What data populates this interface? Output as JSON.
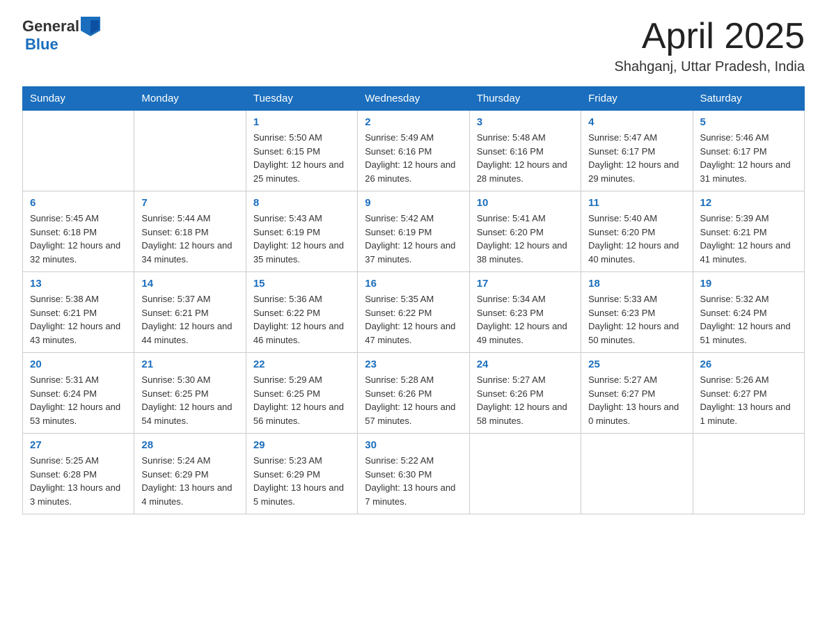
{
  "header": {
    "logo_general": "General",
    "logo_blue": "Blue",
    "month_title": "April 2025",
    "location": "Shahganj, Uttar Pradesh, India"
  },
  "weekdays": [
    "Sunday",
    "Monday",
    "Tuesday",
    "Wednesday",
    "Thursday",
    "Friday",
    "Saturday"
  ],
  "weeks": [
    [
      {
        "day": "",
        "sunrise": "",
        "sunset": "",
        "daylight": ""
      },
      {
        "day": "",
        "sunrise": "",
        "sunset": "",
        "daylight": ""
      },
      {
        "day": "1",
        "sunrise": "Sunrise: 5:50 AM",
        "sunset": "Sunset: 6:15 PM",
        "daylight": "Daylight: 12 hours and 25 minutes."
      },
      {
        "day": "2",
        "sunrise": "Sunrise: 5:49 AM",
        "sunset": "Sunset: 6:16 PM",
        "daylight": "Daylight: 12 hours and 26 minutes."
      },
      {
        "day": "3",
        "sunrise": "Sunrise: 5:48 AM",
        "sunset": "Sunset: 6:16 PM",
        "daylight": "Daylight: 12 hours and 28 minutes."
      },
      {
        "day": "4",
        "sunrise": "Sunrise: 5:47 AM",
        "sunset": "Sunset: 6:17 PM",
        "daylight": "Daylight: 12 hours and 29 minutes."
      },
      {
        "day": "5",
        "sunrise": "Sunrise: 5:46 AM",
        "sunset": "Sunset: 6:17 PM",
        "daylight": "Daylight: 12 hours and 31 minutes."
      }
    ],
    [
      {
        "day": "6",
        "sunrise": "Sunrise: 5:45 AM",
        "sunset": "Sunset: 6:18 PM",
        "daylight": "Daylight: 12 hours and 32 minutes."
      },
      {
        "day": "7",
        "sunrise": "Sunrise: 5:44 AM",
        "sunset": "Sunset: 6:18 PM",
        "daylight": "Daylight: 12 hours and 34 minutes."
      },
      {
        "day": "8",
        "sunrise": "Sunrise: 5:43 AM",
        "sunset": "Sunset: 6:19 PM",
        "daylight": "Daylight: 12 hours and 35 minutes."
      },
      {
        "day": "9",
        "sunrise": "Sunrise: 5:42 AM",
        "sunset": "Sunset: 6:19 PM",
        "daylight": "Daylight: 12 hours and 37 minutes."
      },
      {
        "day": "10",
        "sunrise": "Sunrise: 5:41 AM",
        "sunset": "Sunset: 6:20 PM",
        "daylight": "Daylight: 12 hours and 38 minutes."
      },
      {
        "day": "11",
        "sunrise": "Sunrise: 5:40 AM",
        "sunset": "Sunset: 6:20 PM",
        "daylight": "Daylight: 12 hours and 40 minutes."
      },
      {
        "day": "12",
        "sunrise": "Sunrise: 5:39 AM",
        "sunset": "Sunset: 6:21 PM",
        "daylight": "Daylight: 12 hours and 41 minutes."
      }
    ],
    [
      {
        "day": "13",
        "sunrise": "Sunrise: 5:38 AM",
        "sunset": "Sunset: 6:21 PM",
        "daylight": "Daylight: 12 hours and 43 minutes."
      },
      {
        "day": "14",
        "sunrise": "Sunrise: 5:37 AM",
        "sunset": "Sunset: 6:21 PM",
        "daylight": "Daylight: 12 hours and 44 minutes."
      },
      {
        "day": "15",
        "sunrise": "Sunrise: 5:36 AM",
        "sunset": "Sunset: 6:22 PM",
        "daylight": "Daylight: 12 hours and 46 minutes."
      },
      {
        "day": "16",
        "sunrise": "Sunrise: 5:35 AM",
        "sunset": "Sunset: 6:22 PM",
        "daylight": "Daylight: 12 hours and 47 minutes."
      },
      {
        "day": "17",
        "sunrise": "Sunrise: 5:34 AM",
        "sunset": "Sunset: 6:23 PM",
        "daylight": "Daylight: 12 hours and 49 minutes."
      },
      {
        "day": "18",
        "sunrise": "Sunrise: 5:33 AM",
        "sunset": "Sunset: 6:23 PM",
        "daylight": "Daylight: 12 hours and 50 minutes."
      },
      {
        "day": "19",
        "sunrise": "Sunrise: 5:32 AM",
        "sunset": "Sunset: 6:24 PM",
        "daylight": "Daylight: 12 hours and 51 minutes."
      }
    ],
    [
      {
        "day": "20",
        "sunrise": "Sunrise: 5:31 AM",
        "sunset": "Sunset: 6:24 PM",
        "daylight": "Daylight: 12 hours and 53 minutes."
      },
      {
        "day": "21",
        "sunrise": "Sunrise: 5:30 AM",
        "sunset": "Sunset: 6:25 PM",
        "daylight": "Daylight: 12 hours and 54 minutes."
      },
      {
        "day": "22",
        "sunrise": "Sunrise: 5:29 AM",
        "sunset": "Sunset: 6:25 PM",
        "daylight": "Daylight: 12 hours and 56 minutes."
      },
      {
        "day": "23",
        "sunrise": "Sunrise: 5:28 AM",
        "sunset": "Sunset: 6:26 PM",
        "daylight": "Daylight: 12 hours and 57 minutes."
      },
      {
        "day": "24",
        "sunrise": "Sunrise: 5:27 AM",
        "sunset": "Sunset: 6:26 PM",
        "daylight": "Daylight: 12 hours and 58 minutes."
      },
      {
        "day": "25",
        "sunrise": "Sunrise: 5:27 AM",
        "sunset": "Sunset: 6:27 PM",
        "daylight": "Daylight: 13 hours and 0 minutes."
      },
      {
        "day": "26",
        "sunrise": "Sunrise: 5:26 AM",
        "sunset": "Sunset: 6:27 PM",
        "daylight": "Daylight: 13 hours and 1 minute."
      }
    ],
    [
      {
        "day": "27",
        "sunrise": "Sunrise: 5:25 AM",
        "sunset": "Sunset: 6:28 PM",
        "daylight": "Daylight: 13 hours and 3 minutes."
      },
      {
        "day": "28",
        "sunrise": "Sunrise: 5:24 AM",
        "sunset": "Sunset: 6:29 PM",
        "daylight": "Daylight: 13 hours and 4 minutes."
      },
      {
        "day": "29",
        "sunrise": "Sunrise: 5:23 AM",
        "sunset": "Sunset: 6:29 PM",
        "daylight": "Daylight: 13 hours and 5 minutes."
      },
      {
        "day": "30",
        "sunrise": "Sunrise: 5:22 AM",
        "sunset": "Sunset: 6:30 PM",
        "daylight": "Daylight: 13 hours and 7 minutes."
      },
      {
        "day": "",
        "sunrise": "",
        "sunset": "",
        "daylight": ""
      },
      {
        "day": "",
        "sunrise": "",
        "sunset": "",
        "daylight": ""
      },
      {
        "day": "",
        "sunrise": "",
        "sunset": "",
        "daylight": ""
      }
    ]
  ]
}
